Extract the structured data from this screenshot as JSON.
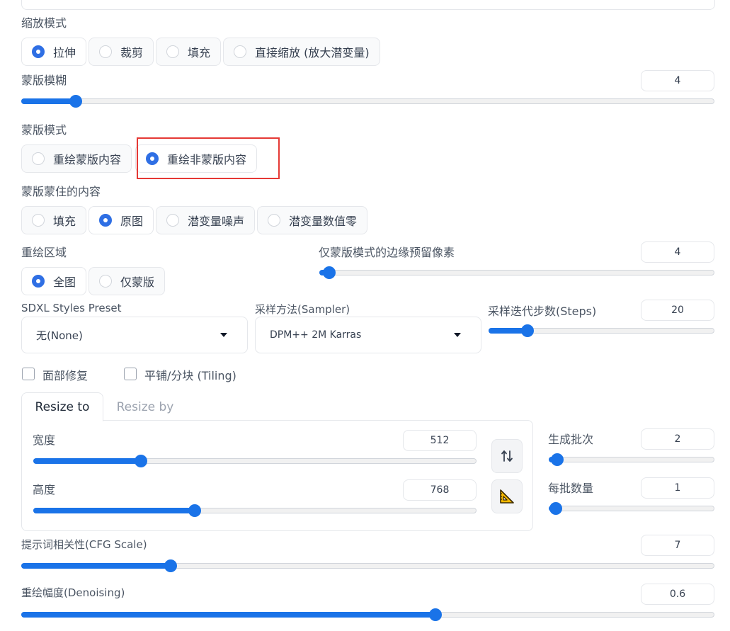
{
  "resize_mode": {
    "label": "缩放模式",
    "options": [
      "拉伸",
      "裁剪",
      "填充",
      "直接缩放 (放大潜变量)"
    ],
    "selected": "拉伸"
  },
  "mask_blur": {
    "label": "蒙版模糊",
    "value": "4",
    "fraction": 0.07
  },
  "mask_mode": {
    "label": "蒙版模式",
    "options": [
      "重绘蒙版内容",
      "重绘非蒙版内容"
    ],
    "selected": "重绘非蒙版内容",
    "highlight_color": "#e53935"
  },
  "masked_content": {
    "label": "蒙版蒙住的内容",
    "options": [
      "填充",
      "原图",
      "潜变量噪声",
      "潜变量数值零"
    ],
    "selected": "原图"
  },
  "inpaint_area": {
    "label": "重绘区域",
    "options": [
      "全图",
      "仅蒙版"
    ],
    "selected": "全图"
  },
  "only_masked_padding": {
    "label": "仅蒙版模式的边缘预留像素",
    "value": "4",
    "fraction": 0.008
  },
  "sdxl_styles": {
    "label": "SDXL Styles Preset",
    "value": "无(None)"
  },
  "sampler": {
    "label": "采样方法(Sampler)",
    "value": "DPM++ 2M Karras"
  },
  "steps": {
    "label": "采样迭代步数(Steps)",
    "value": "20",
    "fraction": 0.15
  },
  "face_restore": {
    "label": "面部修复",
    "checked": false
  },
  "tiling": {
    "label": "平铺/分块 (Tiling)",
    "checked": false
  },
  "resize_tabs": {
    "tabs": [
      "Resize to",
      "Resize by"
    ],
    "active": "Resize to"
  },
  "width": {
    "label": "宽度",
    "value": "512",
    "fraction": 0.235
  },
  "height": {
    "label": "高度",
    "value": "768",
    "fraction": 0.36
  },
  "batch_count": {
    "label": "生成批次",
    "value": "2",
    "fraction": 0.01
  },
  "batch_size": {
    "label": "每批数量",
    "value": "1",
    "fraction": 0.0
  },
  "cfg_scale": {
    "label": "提示词相关性(CFG Scale)",
    "value": "7",
    "fraction": 0.21
  },
  "denoising": {
    "label": "重绘幅度(Denoising)",
    "value": "0.6",
    "fraction": 0.6
  },
  "icons": {
    "swap": "swap-arrows-icon",
    "aspect": "triangle-ruler-icon"
  },
  "accent_color": "#1a73e8"
}
